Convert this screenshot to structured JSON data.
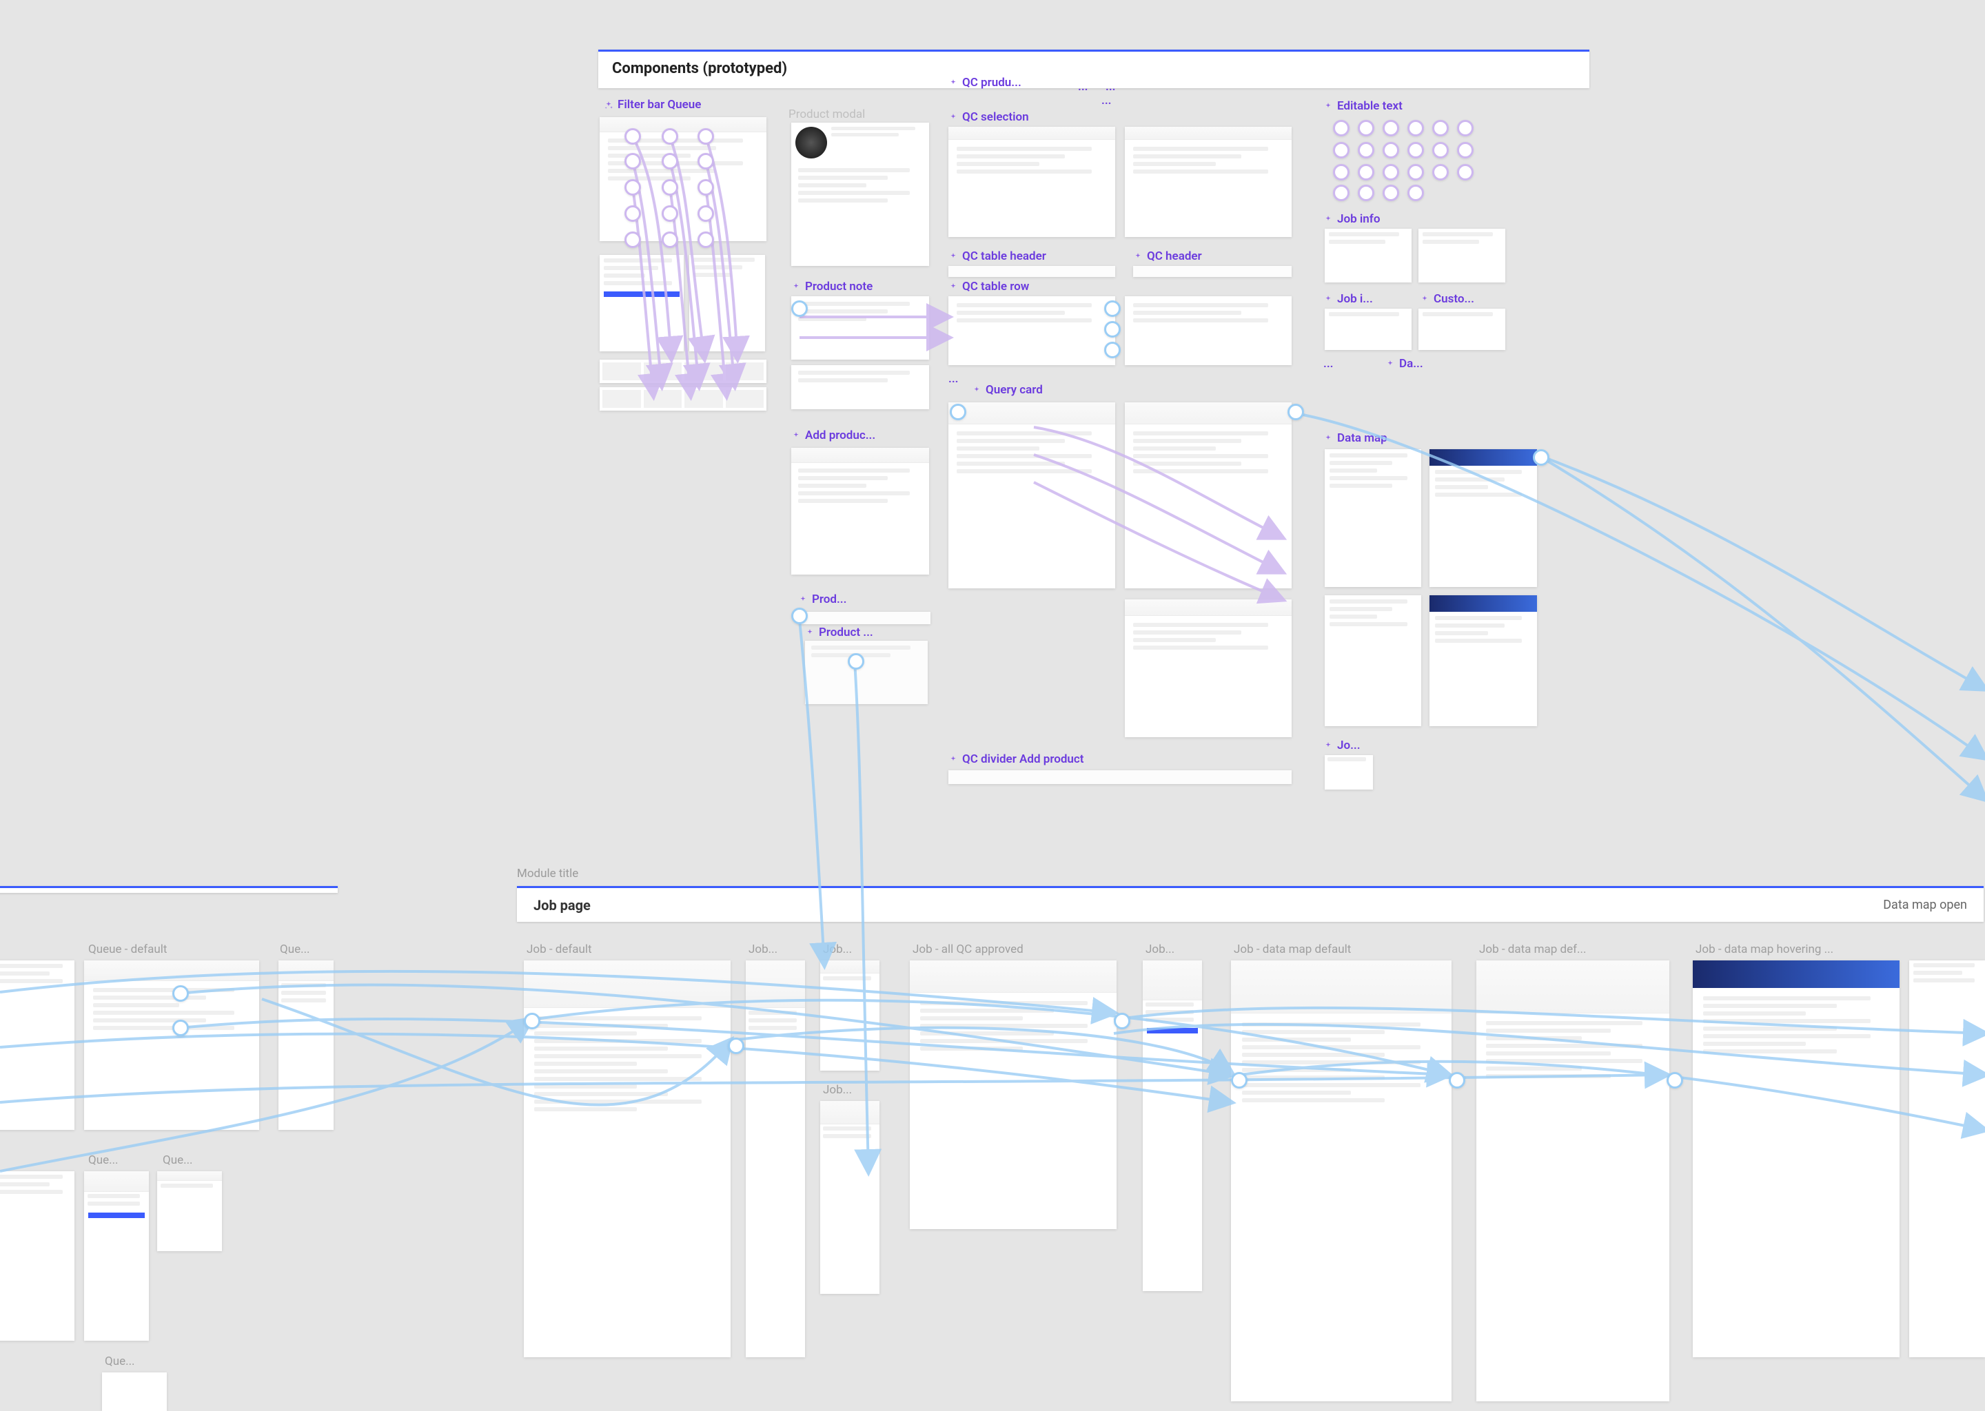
{
  "sections": {
    "components": {
      "title": "Components (prototyped)"
    },
    "module_title": "Module title",
    "job_page": {
      "title": "Job page",
      "right_label": "Data map open"
    }
  },
  "component_labels": {
    "filter_bar_queue": "Filter bar Queue",
    "product_modal": "Product modal",
    "product_note": "Product note",
    "add_produc": "Add produc...",
    "prod": "Prod...",
    "product_": "Product ...",
    "qc_prudu": "QC prudu...",
    "ellipsis1": "...",
    "ellipsis2": "...",
    "ellipsis3": "...",
    "qc_selection": "QC selection",
    "qc_table_header": "QC table header",
    "qc_header": "QC header",
    "qc_table_row": "QC table row",
    "ellipsis4": "...",
    "query_card": "Query card",
    "qc_divider_add": "QC divider Add product",
    "editable_text": "Editable text",
    "job_info": "Job info",
    "job_i": "Job i...",
    "custo": "Custo...",
    "ellipsis5": "...",
    "da": "Da...",
    "data_map": "Data map",
    "jo": "Jo..."
  },
  "frame_labels": {
    "queue_default": "Queue - default",
    "que_short1": "Que...",
    "que_short2": "Que...",
    "que_short3": "Que...",
    "que_short4": "Que...",
    "job_default": "Job - default",
    "job_short1": "Job...",
    "job_short2": "Job...",
    "job_short3": "Job...",
    "job_all_qc": "Job - all QC approved",
    "job_short4": "Job...",
    "job_data_map_default": "Job - data map default",
    "job_data_map_def": "Job - data map def...",
    "job_data_map_hovering": "Job - data map hovering ..."
  }
}
